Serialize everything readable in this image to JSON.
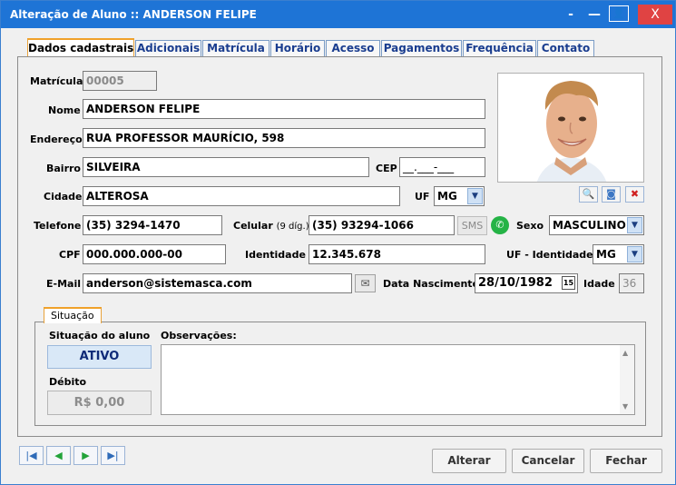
{
  "window": {
    "title": "Alteração de Aluno :: ANDERSON FELIPE",
    "controls": {
      "minimize_glyph": "‑",
      "restore_glyph": "—",
      "contact_glyph": "👤",
      "close_glyph": "X"
    }
  },
  "tabs": [
    {
      "label": "Dados cadastrais",
      "active": true
    },
    {
      "label": "Adicionais"
    },
    {
      "label": "Matrícula"
    },
    {
      "label": "Horário"
    },
    {
      "label": "Acesso"
    },
    {
      "label": "Pagamentos"
    },
    {
      "label": "Frequência"
    },
    {
      "label": "Contato"
    }
  ],
  "form": {
    "matricula": {
      "label": "Matrícula",
      "value": "00005"
    },
    "nome": {
      "label": "Nome",
      "value": "ANDERSON FELIPE"
    },
    "endereco": {
      "label": "Endereço",
      "value": "RUA PROFESSOR MAURÍCIO, 598"
    },
    "bairro": {
      "label": "Bairro",
      "value": "SILVEIRA"
    },
    "cep": {
      "label": "CEP",
      "value": "__.___-___"
    },
    "cidade": {
      "label": "Cidade",
      "value": "ALTEROSA"
    },
    "uf": {
      "label": "UF",
      "value": "MG"
    },
    "telefone": {
      "label": "Telefone",
      "value": "(35) 3294-1470"
    },
    "celular": {
      "label": "Celular",
      "hint": "(9 díg.)",
      "value": "(35) 93294-1066",
      "sms_label": "SMS"
    },
    "sexo": {
      "label": "Sexo",
      "value": "MASCULINO"
    },
    "cpf": {
      "label": "CPF",
      "value": "000.000.000-00"
    },
    "identidade": {
      "label": "Identidade",
      "value": "12.345.678"
    },
    "uf_identidade": {
      "label": "UF - Identidade",
      "value": "MG"
    },
    "email": {
      "label": "E-Mail",
      "value": "anderson@sistemasca.com"
    },
    "data_nascimento": {
      "label": "Data Nascimento",
      "value": "28/10/1982",
      "calendar_glyph": "15"
    },
    "idade": {
      "label": "Idade",
      "value": "36"
    }
  },
  "photo": {
    "icons": [
      "magnify-icon",
      "camera-icon",
      "delete-icon"
    ]
  },
  "situacao": {
    "tab_label": "Situação",
    "status_label": "Situação do aluno",
    "status_value": "ATIVO",
    "debito_label": "Débito",
    "debito_value": "R$ 0,00",
    "observacoes_label": "Observações:"
  },
  "footer": {
    "alterar": "Alterar",
    "cancelar": "Cancelar",
    "fechar": "Fechar"
  },
  "colors": {
    "titlebar": "#1e74d6",
    "close": "#e04343",
    "active_tab_accent": "#f0a12a",
    "status_text": "#0f2a78"
  }
}
